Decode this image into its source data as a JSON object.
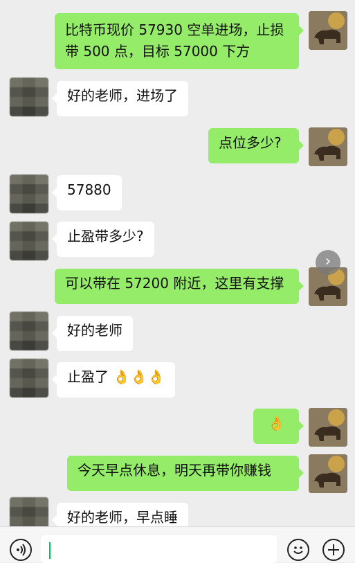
{
  "messages": [
    {
      "side": "right",
      "lines": [
        "比特币现价 57930 空单进场，止损",
        "带 500 点，目标 57000 下方"
      ]
    },
    {
      "side": "left",
      "text": "好的老师，进场了"
    },
    {
      "side": "right",
      "text": "点位多少?"
    },
    {
      "side": "left",
      "text": "57880"
    },
    {
      "side": "left",
      "text": "止盈带多少?"
    },
    {
      "side": "right",
      "text": "可以带在 57200 附近，这里有支撑"
    },
    {
      "side": "left",
      "text": "好的老师"
    },
    {
      "side": "left",
      "text": "止盈了",
      "emoji": "👌👌👌"
    },
    {
      "side": "right",
      "emoji": "👌"
    },
    {
      "side": "right",
      "text": "今天早点休息，明天再带你赚钱"
    },
    {
      "side": "left",
      "text": "好的老师，早点睡"
    }
  ],
  "icons": {
    "voice": "voice-icon",
    "emoji": "emoji-icon",
    "plus": "plus-icon",
    "scroll": "chevron-right-icon"
  },
  "colors": {
    "background": "#ededed",
    "right_bubble": "#95ec69",
    "left_bubble": "#ffffff"
  }
}
